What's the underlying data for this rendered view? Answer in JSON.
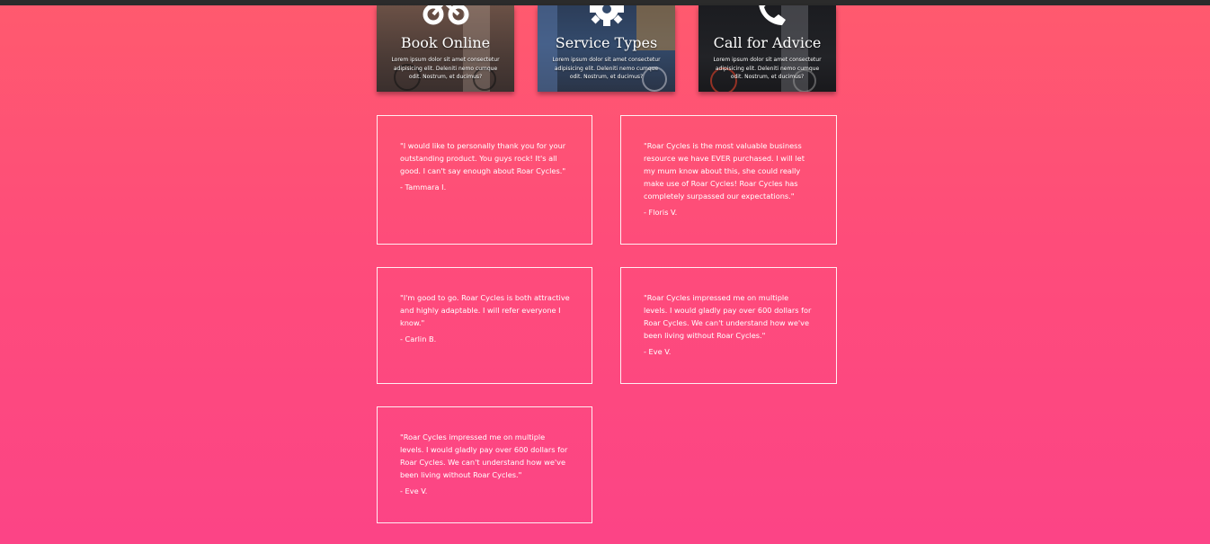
{
  "services": [
    {
      "title": "Book Online",
      "icon": "bicycle-icon",
      "description": "Lorem ipsum dolor sit amet consectetur adipisicing elit. Deleniti nemo cumque odit. Nostrum, et ducimus?"
    },
    {
      "title": "Service Types",
      "icon": "gear-icon",
      "description": "Lorem ipsum dolor sit amet consectetur adipisicing elit. Deleniti nemo cumque odit. Nostrum, et ducimus?"
    },
    {
      "title": "Call for Advice",
      "icon": "phone-icon",
      "description": "Lorem ipsum dolor sit amet consectetur adipisicing elit. Deleniti nemo cumque odit. Nostrum, et ducimus?"
    }
  ],
  "testimonials": [
    {
      "quote": "\"I would like to personally thank you for your outstanding product. You guys rock! It's all good. I can't say enough about Roar Cycles.\"",
      "author": "- Tammara I."
    },
    {
      "quote": "\"Roar Cycles is the most valuable business resource we have EVER purchased. I will let my mum know about this, she could really make use of Roar Cycles! Roar Cycles has completely surpassed our expectations.\"",
      "author": "- Floris V."
    },
    {
      "quote": "\"I'm good to go. Roar Cycles is both attractive and highly adaptable. I will refer everyone I know.\"",
      "author": "- Carlin B."
    },
    {
      "quote": "\"Roar Cycles impressed me on multiple levels. I would gladly pay over 600 dollars for Roar Cycles. We can't understand how we've been living without Roar Cycles.\"",
      "author": "- Eve V."
    },
    {
      "quote": "\"Roar Cycles impressed me on multiple levels. I would gladly pay over 600 dollars for Roar Cycles. We can't understand how we've been living without Roar Cycles.\"",
      "author": "- Eve V."
    }
  ],
  "colors": {
    "top_bar": "#2b2b2b",
    "gradient_top": "#ff5a6e",
    "gradient_bottom": "#fc4486",
    "text": "#ffffff"
  }
}
